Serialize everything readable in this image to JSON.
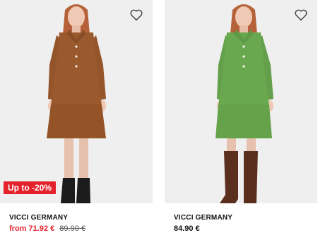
{
  "products": [
    {
      "brand": "VICCI GERMANY",
      "price_from_label": "from",
      "price_current": "71.92 €",
      "price_original": "89.90 €",
      "discount_badge": "Up to -20%",
      "dress_color": "#9a5a2e",
      "favorite_icon": "heart-outline-icon"
    },
    {
      "brand": "VICCI GERMANY",
      "price_current": "84.90 €",
      "dress_color": "#6aa84f",
      "favorite_icon": "heart-outline-icon"
    }
  ],
  "colors": {
    "sale_red": "#e3222c",
    "photo_bg": "#efefef"
  }
}
